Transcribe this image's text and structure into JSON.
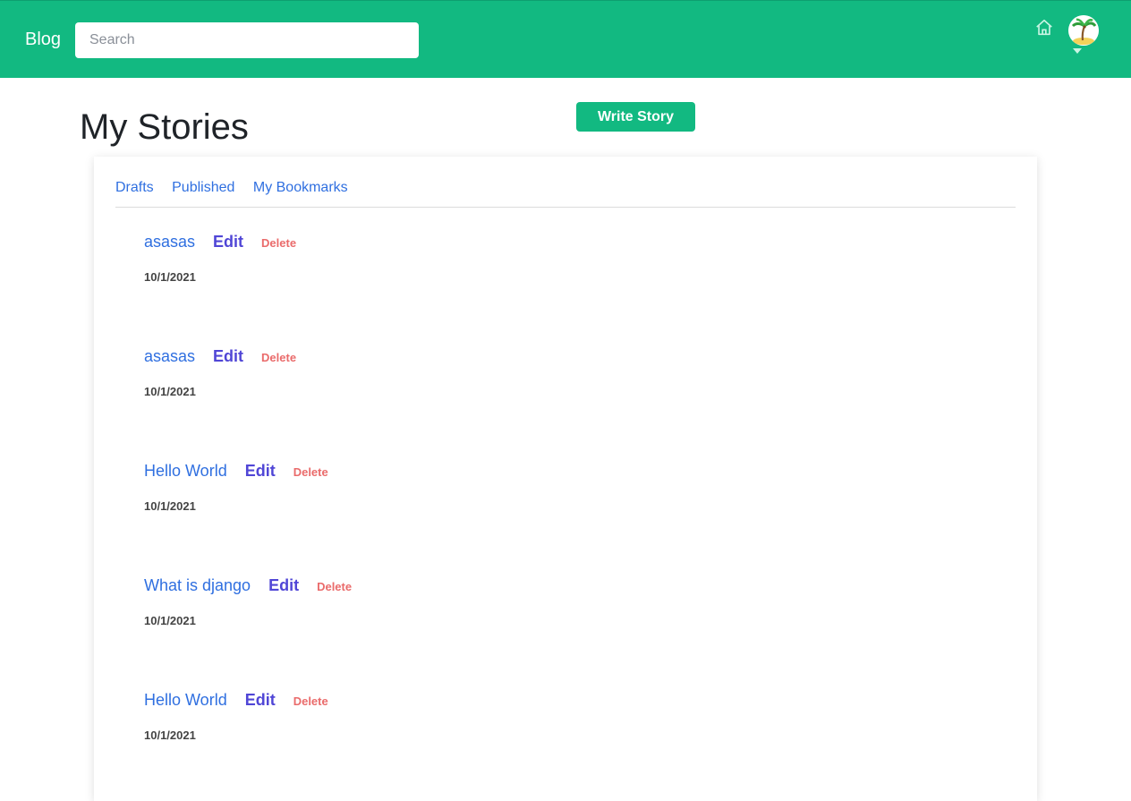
{
  "header": {
    "brand": "Blog",
    "search_placeholder": "Search",
    "icons": {
      "home": "home-icon",
      "avatar": "palm-tree-avatar",
      "menu": "caret-down-icon"
    },
    "colors": {
      "bar": "#12b981",
      "accent": "#12b981"
    }
  },
  "page": {
    "title": "My Stories",
    "write_button": "Write Story"
  },
  "tabs": [
    {
      "label": "Drafts"
    },
    {
      "label": "Published"
    },
    {
      "label": "My Bookmarks"
    }
  ],
  "stories": [
    {
      "title": "asasas",
      "edit": "Edit",
      "delete": "Delete",
      "date": "10/1/2021"
    },
    {
      "title": "asasas",
      "edit": "Edit",
      "delete": "Delete",
      "date": "10/1/2021"
    },
    {
      "title": "Hello World",
      "edit": "Edit",
      "delete": "Delete",
      "date": "10/1/2021"
    },
    {
      "title": "What is django",
      "edit": "Edit",
      "delete": "Delete",
      "date": "10/1/2021"
    },
    {
      "title": "Hello World",
      "edit": "Edit",
      "delete": "Delete",
      "date": "10/1/2021"
    }
  ]
}
